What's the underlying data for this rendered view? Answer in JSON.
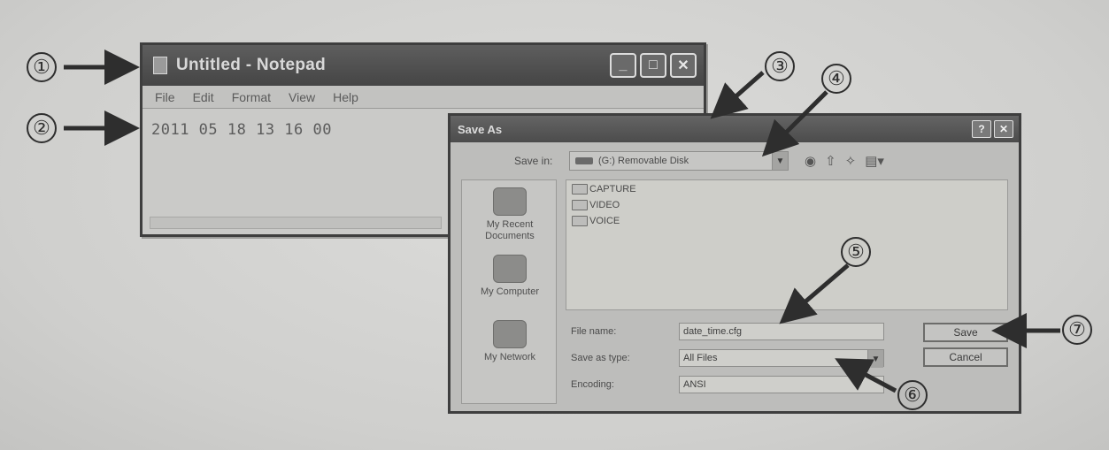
{
  "notepad": {
    "title": "Untitled - Notepad",
    "controls": {
      "minimize": "_",
      "maximize": "□",
      "close": "✕"
    },
    "menu": [
      "File",
      "Edit",
      "Format",
      "View",
      "Help"
    ],
    "content": "2011 05 18 13 16 00"
  },
  "save_as": {
    "title": "Save As",
    "controls": {
      "help": "?",
      "close": "✕"
    },
    "save_in_label": "Save in:",
    "save_in_value": "(G:) Removable Disk",
    "places": [
      "My Recent Documents",
      "My Computer",
      "My Network"
    ],
    "folders": [
      "CAPTURE",
      "VIDEO",
      "VOICE"
    ],
    "file_name_label": "File name:",
    "file_name_value": "date_time.cfg",
    "save_as_type_label": "Save as type:",
    "save_as_type_value": "All Files",
    "encoding_label": "Encoding:",
    "encoding_value": "ANSI",
    "save_button": "Save",
    "cancel_button": "Cancel"
  },
  "callouts": [
    "①",
    "②",
    "③",
    "④",
    "⑤",
    "⑥",
    "⑦"
  ],
  "colors": {
    "background": "#d4d4d2",
    "titlebar": "#4c4c4c",
    "arrow": "#2e2e2e"
  }
}
